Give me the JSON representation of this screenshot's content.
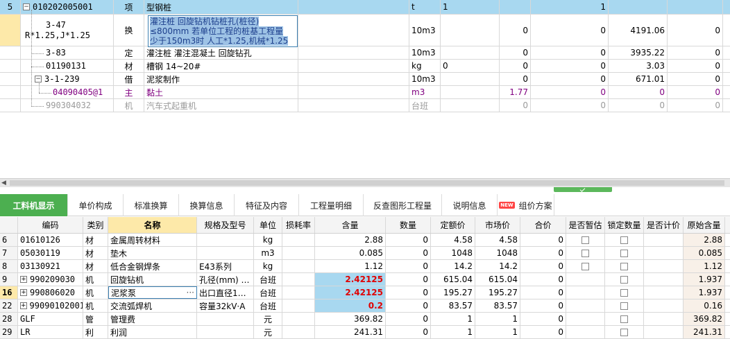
{
  "upper_rows": [
    {
      "idx": "5",
      "code": "010202005001",
      "type": "项",
      "name": "型钢桩",
      "unit": "t",
      "c6": "1",
      "c8": "1",
      "c9": "",
      "c10": ""
    },
    {
      "idx": "",
      "code": "3-47",
      "code2": "R*1.25,J*1.25",
      "type": "换",
      "name_lines": [
        "灌注桩 回旋钻机钻桩孔(桩径)",
        "≤800mm 若单位工程的桩基工程量",
        "少于150m3时 人工*1.25,机械*1.25"
      ],
      "unit": "10m3",
      "c6": "",
      "c7": "0",
      "c8": "0",
      "c9": "4191.06",
      "c10": "0"
    },
    {
      "idx": "",
      "code": "3-83",
      "type": "定",
      "name": "灌注桩 灌注混凝土 回旋钻孔",
      "unit": "10m3",
      "c6": "",
      "c7": "0",
      "c8": "0",
      "c9": "3935.22",
      "c10": "0"
    },
    {
      "idx": "",
      "code": "01190131",
      "type": "材",
      "name": "槽钢 14~20#",
      "unit": "kg",
      "c6": "0",
      "c7": "0",
      "c8": "0",
      "c9": "3.03",
      "c10": "0"
    },
    {
      "idx": "",
      "code": "3-1-239",
      "type": "借",
      "name": "泥浆制作",
      "unit": "10m3",
      "c6": "",
      "c7": "0",
      "c8": "0",
      "c9": "671.01",
      "c10": "0"
    },
    {
      "idx": "",
      "code": "04090405@1",
      "type": "主",
      "name": "黏土",
      "unit": "m3",
      "c6": "",
      "c7": "1.77",
      "c8": "0",
      "c9": "0",
      "c10": "0"
    },
    {
      "idx": "",
      "code": "990304032",
      "type": "机",
      "name": "汽车式起重机",
      "unit": "台班",
      "c6": "",
      "c7": "0",
      "c8": "0",
      "c9": "0",
      "c10": "0"
    }
  ],
  "tabs": [
    "工料机显示",
    "单价构成",
    "标准换算",
    "换算信息",
    "特征及内容",
    "工程量明细",
    "反查图形工程量",
    "说明信息",
    "组价方案"
  ],
  "new_badge": "NEW",
  "lower_headers": [
    "",
    "编码",
    "类别",
    "名称",
    "规格及型号",
    "单位",
    "损耗率",
    "含量",
    "数量",
    "定额价",
    "市场价",
    "合价",
    "是否暂估",
    "锁定数量",
    "是否计价",
    "原始含量"
  ],
  "lower_rows": [
    {
      "idx": "6",
      "code": "01610126",
      "type": "材",
      "name": "金属周转材料",
      "spec": "",
      "unit": "kg",
      "loss": "",
      "content": "2.88",
      "qty": "0",
      "quota": "4.58",
      "market": "4.58",
      "total": "0",
      "est": true,
      "lock": true,
      "price": false,
      "orig": "2.88"
    },
    {
      "idx": "7",
      "code": "05030119",
      "type": "材",
      "name": "垫木",
      "spec": "",
      "unit": "m3",
      "loss": "",
      "content": "0.085",
      "qty": "0",
      "quota": "1048",
      "market": "1048",
      "total": "0",
      "est": true,
      "lock": true,
      "price": false,
      "orig": "0.085"
    },
    {
      "idx": "8",
      "code": "03130921",
      "type": "材",
      "name": "低合金钢焊条",
      "spec": "E43系列",
      "unit": "kg",
      "loss": "",
      "content": "1.12",
      "qty": "0",
      "quota": "14.2",
      "market": "14.2",
      "total": "0",
      "est": true,
      "lock": true,
      "price": false,
      "orig": "1.12"
    },
    {
      "idx": "9",
      "code": "990209030",
      "type": "机",
      "name": "回旋钻机",
      "spec": "孔径(mm) …",
      "unit": "台班",
      "loss": "",
      "content": "2.42125",
      "qty": "0",
      "quota": "615.04",
      "market": "615.04",
      "total": "0",
      "est": false,
      "lock": true,
      "price": false,
      "orig": "1.937"
    },
    {
      "idx": "16",
      "code": "990806020",
      "type": "机",
      "name": "泥浆泵",
      "spec": "出口直径1…",
      "unit": "台班",
      "loss": "",
      "content": "2.42125",
      "qty": "0",
      "quota": "195.27",
      "market": "195.27",
      "total": "0",
      "est": false,
      "lock": true,
      "price": false,
      "orig": "1.937"
    },
    {
      "idx": "22",
      "code": "99090102001",
      "type": "机",
      "name": "交流弧焊机",
      "spec": "容量32kV·A",
      "unit": "台班",
      "loss": "",
      "content": "0.2",
      "qty": "0",
      "quota": "83.57",
      "market": "83.57",
      "total": "0",
      "est": false,
      "lock": true,
      "price": false,
      "orig": "0.16"
    },
    {
      "idx": "28",
      "code": "GLF",
      "type": "管",
      "name": "管理费",
      "spec": "",
      "unit": "元",
      "loss": "",
      "content": "369.82",
      "qty": "0",
      "quota": "1",
      "market": "1",
      "total": "0",
      "est": false,
      "lock": true,
      "price": false,
      "orig": "369.82"
    },
    {
      "idx": "29",
      "code": "LR",
      "type": "利",
      "name": "利润",
      "spec": "",
      "unit": "元",
      "loss": "",
      "content": "241.31",
      "qty": "0",
      "quota": "1",
      "market": "1",
      "total": "0",
      "est": false,
      "lock": true,
      "price": false,
      "orig": "241.31"
    }
  ]
}
